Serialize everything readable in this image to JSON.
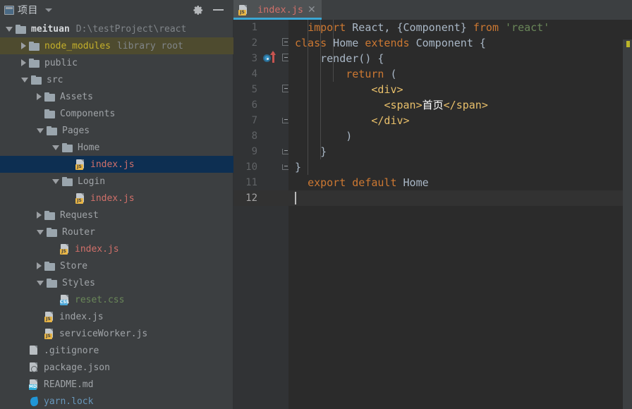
{
  "sidebar": {
    "title": "项目",
    "title_icon": "project-window-icon",
    "dropdown_icon": "chevron-down-icon",
    "settings_icon": "gear-icon",
    "collapse_icon": "minimize-icon",
    "tree": [
      {
        "label": "meituan",
        "sublabel": "D:\\testProject\\react",
        "icon": "folder-icon",
        "indent": 0,
        "arrow": "down",
        "state": "normal",
        "color": "bold-white"
      },
      {
        "label": "node_modules",
        "sublabel": "library root",
        "icon": "folder-icon",
        "indent": 1,
        "arrow": "right",
        "state": "hover",
        "color": "yellow"
      },
      {
        "label": "public",
        "sublabel": "",
        "icon": "folder-icon",
        "indent": 1,
        "arrow": "right",
        "state": "normal",
        "color": "gray"
      },
      {
        "label": "src",
        "sublabel": "",
        "icon": "folder-icon",
        "indent": 1,
        "arrow": "down",
        "state": "normal",
        "color": "gray"
      },
      {
        "label": "Assets",
        "sublabel": "",
        "icon": "folder-icon",
        "indent": 2,
        "arrow": "right",
        "state": "normal",
        "color": "gray"
      },
      {
        "label": "Components",
        "sublabel": "",
        "icon": "folder-icon",
        "indent": 2,
        "arrow": "none",
        "state": "normal",
        "color": "gray"
      },
      {
        "label": "Pages",
        "sublabel": "",
        "icon": "folder-icon",
        "indent": 2,
        "arrow": "down",
        "state": "normal",
        "color": "gray"
      },
      {
        "label": "Home",
        "sublabel": "",
        "icon": "folder-icon",
        "indent": 3,
        "arrow": "down",
        "state": "normal",
        "color": "gray"
      },
      {
        "label": "index.js",
        "sublabel": "",
        "icon": "js-file-icon",
        "indent": 4,
        "arrow": "none",
        "state": "selected",
        "color": "red"
      },
      {
        "label": "Login",
        "sublabel": "",
        "icon": "folder-icon",
        "indent": 3,
        "arrow": "down",
        "state": "normal",
        "color": "gray"
      },
      {
        "label": "index.js",
        "sublabel": "",
        "icon": "js-file-icon",
        "indent": 4,
        "arrow": "none",
        "state": "normal",
        "color": "red"
      },
      {
        "label": "Request",
        "sublabel": "",
        "icon": "folder-icon",
        "indent": 2,
        "arrow": "right",
        "state": "normal",
        "color": "gray"
      },
      {
        "label": "Router",
        "sublabel": "",
        "icon": "folder-icon",
        "indent": 2,
        "arrow": "down",
        "state": "normal",
        "color": "gray"
      },
      {
        "label": "index.js",
        "sublabel": "",
        "icon": "js-file-icon",
        "indent": 3,
        "arrow": "none",
        "state": "normal",
        "color": "red"
      },
      {
        "label": "Store",
        "sublabel": "",
        "icon": "folder-icon",
        "indent": 2,
        "arrow": "right",
        "state": "normal",
        "color": "gray"
      },
      {
        "label": "Styles",
        "sublabel": "",
        "icon": "folder-icon",
        "indent": 2,
        "arrow": "down",
        "state": "normal",
        "color": "gray"
      },
      {
        "label": "reset.css",
        "sublabel": "",
        "icon": "css-file-icon",
        "indent": 3,
        "arrow": "none",
        "state": "normal",
        "color": "green"
      },
      {
        "label": "index.js",
        "sublabel": "",
        "icon": "js-file-icon",
        "indent": 2,
        "arrow": "none",
        "state": "normal",
        "color": "gray"
      },
      {
        "label": "serviceWorker.js",
        "sublabel": "",
        "icon": "js-file-icon",
        "indent": 2,
        "arrow": "none",
        "state": "normal",
        "color": "gray"
      },
      {
        "label": ".gitignore",
        "sublabel": "",
        "icon": "git-file-icon",
        "indent": 1,
        "arrow": "none",
        "state": "normal",
        "color": "gray"
      },
      {
        "label": "package.json",
        "sublabel": "",
        "icon": "json-file-icon",
        "indent": 1,
        "arrow": "none",
        "state": "normal",
        "color": "gray"
      },
      {
        "label": "README.md",
        "sublabel": "",
        "icon": "md-file-icon",
        "indent": 1,
        "arrow": "none",
        "state": "normal",
        "color": "gray"
      },
      {
        "label": "yarn.lock",
        "sublabel": "",
        "icon": "yarn-file-icon",
        "indent": 1,
        "arrow": "none",
        "state": "normal",
        "color": "blue"
      }
    ]
  },
  "editor": {
    "tab": {
      "label": "index.js",
      "icon": "js-file-icon",
      "close_icon": "close-icon",
      "active": true
    },
    "gutter_markers": {
      "breakpoint_line": 3,
      "breakpoint_icon": "breakpoint-run-icon"
    },
    "cursor_line": 12,
    "warning_marker_icon": "warning-stripe-icon",
    "lines": [
      {
        "n": 1,
        "tokens": [
          {
            "t": "  ",
            "c": "plain"
          },
          {
            "t": "import",
            "c": "kw"
          },
          {
            "t": " React, {Component} ",
            "c": "id"
          },
          {
            "t": "from",
            "c": "kw"
          },
          {
            "t": " ",
            "c": "id"
          },
          {
            "t": "'react'",
            "c": "str"
          }
        ]
      },
      {
        "n": 2,
        "tokens": [
          {
            "t": "",
            "c": "plain"
          },
          {
            "t": "class",
            "c": "kw"
          },
          {
            "t": " Home ",
            "c": "id"
          },
          {
            "t": "extends",
            "c": "kw"
          },
          {
            "t": " Component {",
            "c": "id"
          }
        ]
      },
      {
        "n": 3,
        "tokens": [
          {
            "t": "    render() {",
            "c": "id"
          }
        ]
      },
      {
        "n": 4,
        "tokens": [
          {
            "t": "        ",
            "c": "plain"
          },
          {
            "t": "return",
            "c": "kw"
          },
          {
            "t": " (",
            "c": "id"
          }
        ]
      },
      {
        "n": 5,
        "tokens": [
          {
            "t": "            ",
            "c": "plain"
          },
          {
            "t": "<div>",
            "c": "tag"
          }
        ]
      },
      {
        "n": 6,
        "tokens": [
          {
            "t": "              ",
            "c": "plain"
          },
          {
            "t": "<span>",
            "c": "tag"
          },
          {
            "t": "首页",
            "c": "cn"
          },
          {
            "t": "</span>",
            "c": "tag"
          }
        ]
      },
      {
        "n": 7,
        "tokens": [
          {
            "t": "            ",
            "c": "plain"
          },
          {
            "t": "</div>",
            "c": "tag"
          }
        ]
      },
      {
        "n": 8,
        "tokens": [
          {
            "t": "        )",
            "c": "id"
          }
        ]
      },
      {
        "n": 9,
        "tokens": [
          {
            "t": "    }",
            "c": "id"
          }
        ]
      },
      {
        "n": 10,
        "tokens": [
          {
            "t": "}",
            "c": "id"
          }
        ]
      },
      {
        "n": 11,
        "tokens": [
          {
            "t": "  ",
            "c": "plain"
          },
          {
            "t": "export default",
            "c": "kw"
          },
          {
            "t": " Home",
            "c": "id"
          }
        ]
      },
      {
        "n": 12,
        "tokens": [
          {
            "t": "",
            "c": "plain"
          }
        ]
      }
    ]
  }
}
